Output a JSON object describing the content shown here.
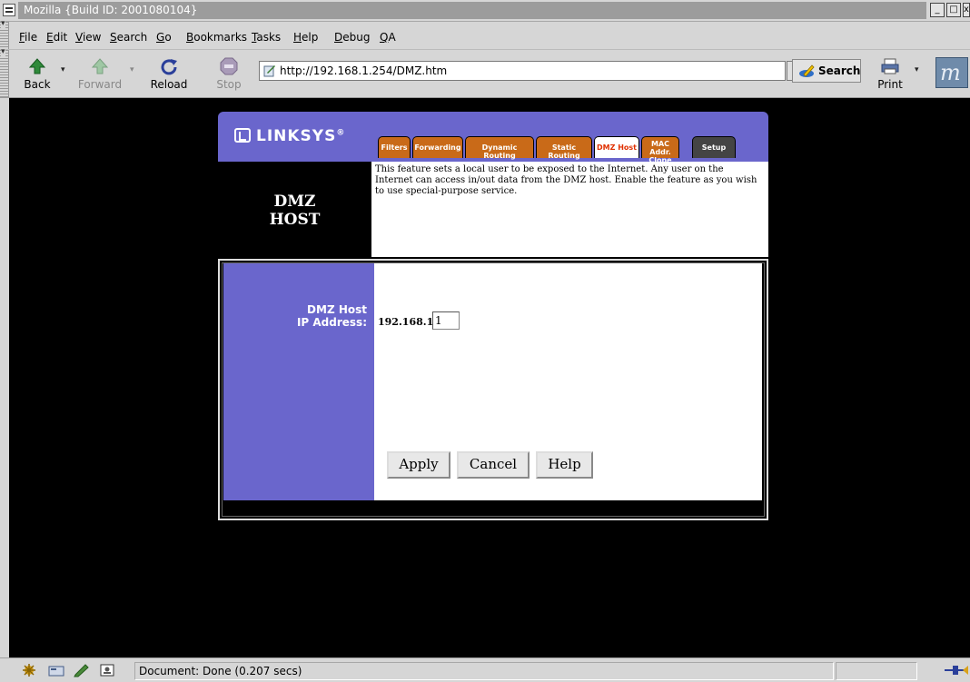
{
  "window": {
    "title": "Mozilla {Build ID: 2001080104}",
    "minimize_glyph": "_",
    "maximize_glyph": "□",
    "close_glyph": "x"
  },
  "menubar": {
    "items": [
      {
        "pre": "",
        "mn": "F",
        "post": "ile"
      },
      {
        "pre": "",
        "mn": "E",
        "post": "dit"
      },
      {
        "pre": "",
        "mn": "V",
        "post": "iew"
      },
      {
        "pre": "",
        "mn": "S",
        "post": "earch"
      },
      {
        "pre": "",
        "mn": "G",
        "post": "o"
      },
      {
        "pre": "",
        "mn": "B",
        "post": "ookmarks"
      },
      {
        "pre": "",
        "mn": "T",
        "post": "asks"
      },
      {
        "pre": "",
        "mn": "H",
        "post": "elp"
      },
      {
        "pre": "",
        "mn": "D",
        "post": "ebug"
      },
      {
        "pre": "",
        "mn": "Q",
        "post": "A"
      }
    ]
  },
  "toolbar": {
    "back_label": "Back",
    "forward_label": "Forward",
    "reload_label": "Reload",
    "stop_label": "Stop",
    "url": "http://192.168.1.254/DMZ.htm",
    "search_label": "Search",
    "print_label": "Print",
    "logo_letter": "m",
    "dropdown_glyph": "▾"
  },
  "page": {
    "brand": "LINKSYS",
    "brand_mark": "®",
    "tabs": [
      {
        "label": "Filters",
        "state": "normal"
      },
      {
        "label": "Forwarding",
        "state": "normal"
      },
      {
        "label": "Dynamic Routing",
        "state": "normal"
      },
      {
        "label": "Static Routing",
        "state": "normal"
      },
      {
        "label": "DMZ Host",
        "state": "active"
      },
      {
        "label": "MAC Addr. Clone",
        "state": "normal"
      },
      {
        "label": "Setup",
        "state": "setup"
      }
    ],
    "heading_line1": "DMZ",
    "heading_line2": "HOST",
    "description": "This feature sets a local user to be exposed to the Internet. Any user on the Internet can access in/out data from the DMZ host. Enable the feature as you wish to use special-purpose service.",
    "field_label_line1": "DMZ Host",
    "field_label_line2": "IP Address:",
    "ip_prefix": "192.168.1.",
    "ip_last_octet": "1",
    "buttons": {
      "apply": "Apply",
      "cancel": "Cancel",
      "help": "Help"
    },
    "colors": {
      "brand_purple": "#6a66cc",
      "tab_orange": "#c96a18",
      "active_tab_text": "#e03000"
    }
  },
  "statusbar": {
    "text": "Document: Done (0.207 secs)"
  }
}
